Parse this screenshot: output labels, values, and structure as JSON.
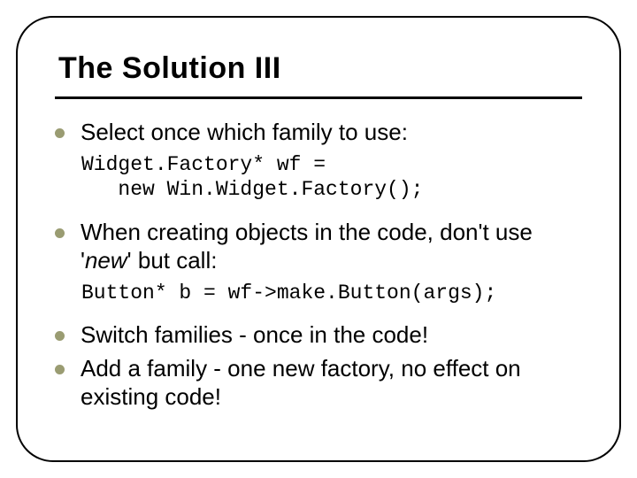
{
  "slide": {
    "title": "The Solution III",
    "bullets": [
      {
        "text": "Select once which family to use:",
        "code": "Widget.Factory* wf =\n   new Win.Widget.Factory();"
      },
      {
        "text_pre": "When creating objects in the code, don't use '",
        "text_em": "new",
        "text_post": "' but call:",
        "code": "Button* b = wf->make.Button(args);"
      },
      {
        "text": "Switch families - once in the code!"
      },
      {
        "text": "Add a family - one new factory, no effect on existing code!"
      }
    ]
  },
  "colors": {
    "bullet": "#9a9c72",
    "text": "#000000"
  }
}
